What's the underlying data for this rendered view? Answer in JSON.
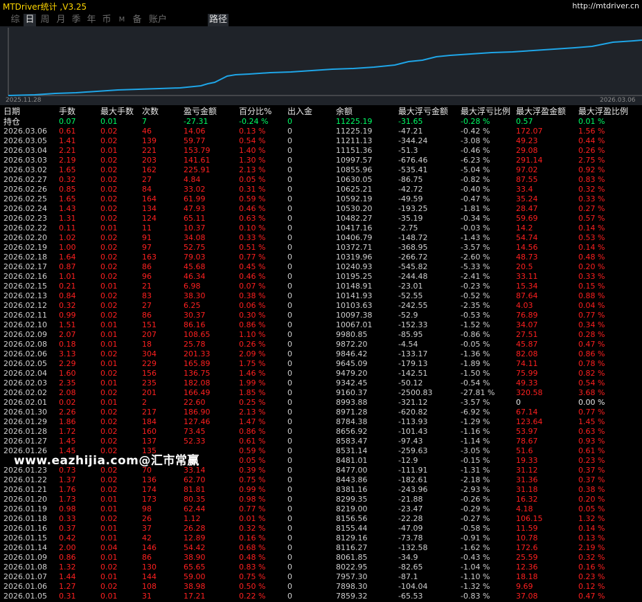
{
  "app": {
    "title": "MTDriver统计 ,V3.25",
    "link": "http://mtdriver.cn"
  },
  "tabs": [
    {
      "label": "综",
      "active": false
    },
    {
      "label": "日",
      "active": true
    },
    {
      "label": "周",
      "active": false
    },
    {
      "label": "月",
      "active": false
    },
    {
      "label": "季",
      "active": false
    },
    {
      "label": "年",
      "active": false
    },
    {
      "label": "币",
      "active": false
    },
    {
      "label": "M",
      "active": false
    },
    {
      "label": "备",
      "active": false
    },
    {
      "label": "账户",
      "active": false
    },
    {
      "label": "路径",
      "active": true
    }
  ],
  "chart": {
    "start_date": "2025.11.28",
    "end_date": "2026.03.06",
    "line_color": "#1fa6e8"
  },
  "headers": [
    "日期",
    "手数",
    "最大手数",
    "次数",
    "盈亏金额",
    "百分比%",
    "出入金",
    "余额",
    "最大浮亏金额",
    "最大浮亏比例",
    "最大浮盈金额",
    "最大浮盈比例"
  ],
  "holding": [
    "持仓",
    "0.07",
    "0.01",
    "7",
    "-27.31",
    "-0.24 %",
    "0",
    "11225.19",
    "-31.65",
    "-0.28 %",
    "0.57",
    "0.01 %"
  ],
  "rows": [
    [
      "2026.03.06",
      "0.61",
      "0.02",
      "46",
      "14.06",
      "0.13 %",
      "0",
      "11225.19",
      "-47.21",
      "-0.42 %",
      "172.07",
      "1.56 %"
    ],
    [
      "2026.03.05",
      "1.41",
      "0.02",
      "139",
      "59.77",
      "0.54 %",
      "0",
      "11211.13",
      "-344.24",
      "-3.08 %",
      "49.23",
      "0.44 %"
    ],
    [
      "2026.03.04",
      "2.21",
      "0.01",
      "221",
      "153.79",
      "1.40 %",
      "0",
      "11151.36",
      "-51.3",
      "-0.46 %",
      "29.08",
      "0.26 %"
    ],
    [
      "2026.03.03",
      "2.19",
      "0.02",
      "203",
      "141.61",
      "1.30 %",
      "0",
      "10997.57",
      "-676.46",
      "-6.23 %",
      "291.14",
      "2.75 %"
    ],
    [
      "2026.03.02",
      "1.65",
      "0.02",
      "162",
      "225.91",
      "2.13 %",
      "0",
      "10855.96",
      "-535.41",
      "-5.04 %",
      "97.02",
      "0.92 %"
    ],
    [
      "2026.02.27",
      "0.32",
      "0.02",
      "27",
      "4.84",
      "0.05 %",
      "0",
      "10630.05",
      "-86.75",
      "-0.82 %",
      "87.55",
      "0.83 %"
    ],
    [
      "2026.02.26",
      "0.85",
      "0.02",
      "84",
      "33.02",
      "0.31 %",
      "0",
      "10625.21",
      "-42.72",
      "-0.40 %",
      "33.4",
      "0.32 %"
    ],
    [
      "2026.02.25",
      "1.65",
      "0.02",
      "164",
      "61.99",
      "0.59 %",
      "0",
      "10592.19",
      "-49.59",
      "-0.47 %",
      "35.24",
      "0.33 %"
    ],
    [
      "2026.02.24",
      "1.43",
      "0.02",
      "134",
      "47.93",
      "0.46 %",
      "0",
      "10530.20",
      "-193.25",
      "-1.81 %",
      "28.47",
      "0.27 %"
    ],
    [
      "2026.02.23",
      "1.31",
      "0.02",
      "124",
      "65.11",
      "0.63 %",
      "0",
      "10482.27",
      "-35.19",
      "-0.34 %",
      "59.69",
      "0.57 %"
    ],
    [
      "2026.02.22",
      "0.11",
      "0.01",
      "11",
      "10.37",
      "0.10 %",
      "0",
      "10417.16",
      "-2.75",
      "-0.03 %",
      "14.2",
      "0.14 %"
    ],
    [
      "2026.02.20",
      "1.02",
      "0.02",
      "91",
      "34.08",
      "0.33 %",
      "0",
      "10406.79",
      "-148.72",
      "-1.43 %",
      "54.74",
      "0.53 %"
    ],
    [
      "2026.02.19",
      "1.00",
      "0.02",
      "97",
      "52.75",
      "0.51 %",
      "0",
      "10372.71",
      "-368.95",
      "-3.57 %",
      "14.56",
      "0.14 %"
    ],
    [
      "2026.02.18",
      "1.64",
      "0.02",
      "163",
      "79.03",
      "0.77 %",
      "0",
      "10319.96",
      "-266.72",
      "-2.60 %",
      "48.73",
      "0.48 %"
    ],
    [
      "2026.02.17",
      "0.87",
      "0.02",
      "86",
      "45.68",
      "0.45 %",
      "0",
      "10240.93",
      "-545.82",
      "-5.33 %",
      "20.5",
      "0.20 %"
    ],
    [
      "2026.02.16",
      "1.01",
      "0.02",
      "96",
      "46.34",
      "0.46 %",
      "0",
      "10195.25",
      "-244.48",
      "-2.41 %",
      "33.11",
      "0.33 %"
    ],
    [
      "2026.02.15",
      "0.21",
      "0.01",
      "21",
      "6.98",
      "0.07 %",
      "0",
      "10148.91",
      "-23.01",
      "-0.23 %",
      "15.34",
      "0.15 %"
    ],
    [
      "2026.02.13",
      "0.84",
      "0.02",
      "83",
      "38.30",
      "0.38 %",
      "0",
      "10141.93",
      "-52.55",
      "-0.52 %",
      "87.64",
      "0.88 %"
    ],
    [
      "2026.02.12",
      "0.32",
      "0.02",
      "27",
      "6.25",
      "0.06 %",
      "0",
      "10103.63",
      "-242.55",
      "-2.35 %",
      "4.03",
      "0.04 %"
    ],
    [
      "2026.02.11",
      "0.99",
      "0.02",
      "86",
      "30.37",
      "0.30 %",
      "0",
      "10097.38",
      "-52.9",
      "-0.53 %",
      "76.89",
      "0.77 %"
    ],
    [
      "2026.02.10",
      "1.51",
      "0.01",
      "151",
      "86.16",
      "0.86 %",
      "0",
      "10067.01",
      "-152.33",
      "-1.52 %",
      "34.07",
      "0.34 %"
    ],
    [
      "2026.02.09",
      "2.07",
      "0.01",
      "207",
      "108.65",
      "1.10 %",
      "0",
      "9980.85",
      "-85.95",
      "-0.86 %",
      "27.51",
      "0.28 %"
    ],
    [
      "2026.02.08",
      "0.18",
      "0.01",
      "18",
      "25.78",
      "0.26 %",
      "0",
      "9872.20",
      "-4.54",
      "-0.05 %",
      "45.87",
      "0.47 %"
    ],
    [
      "2026.02.06",
      "3.13",
      "0.02",
      "304",
      "201.33",
      "2.09 %",
      "0",
      "9846.42",
      "-133.17",
      "-1.36 %",
      "82.08",
      "0.86 %"
    ],
    [
      "2026.02.05",
      "2.29",
      "0.01",
      "229",
      "165.89",
      "1.75 %",
      "0",
      "9645.09",
      "-179.13",
      "-1.89 %",
      "74.11",
      "0.78 %"
    ],
    [
      "2026.02.04",
      "1.60",
      "0.02",
      "156",
      "136.75",
      "1.46 %",
      "0",
      "9479.20",
      "-142.51",
      "-1.50 %",
      "75.99",
      "0.82 %"
    ],
    [
      "2026.02.03",
      "2.35",
      "0.01",
      "235",
      "182.08",
      "1.99 %",
      "0",
      "9342.45",
      "-50.12",
      "-0.54 %",
      "49.33",
      "0.54 %"
    ],
    [
      "2026.02.02",
      "2.08",
      "0.02",
      "201",
      "166.49",
      "1.85 %",
      "0",
      "9160.37",
      "-2500.83",
      "-27.81 %",
      "320.58",
      "3.68 %"
    ],
    [
      "2026.02.01",
      "0.02",
      "0.01",
      "2",
      "22.60",
      "0.25 %",
      "0",
      "8993.88",
      "-321.12",
      "-3.57 %",
      "0",
      "0.00 %"
    ],
    [
      "2026.01.30",
      "2.26",
      "0.02",
      "217",
      "186.90",
      "2.13 %",
      "0",
      "8971.28",
      "-620.82",
      "-6.92 %",
      "67.14",
      "0.77 %"
    ],
    [
      "2026.01.29",
      "1.86",
      "0.02",
      "184",
      "127.46",
      "1.47 %",
      "0",
      "8784.38",
      "-113.93",
      "-1.29 %",
      "123.64",
      "1.45 %"
    ],
    [
      "2026.01.28",
      "1.72",
      "0.02",
      "160",
      "73.45",
      "0.86 %",
      "0",
      "8656.92",
      "-101.43",
      "-1.16 %",
      "53.97",
      "0.63 %"
    ],
    [
      "2026.01.27",
      "1.45",
      "0.02",
      "137",
      "52.33",
      "0.61 %",
      "0",
      "8583.47",
      "-97.43",
      "-1.14 %",
      "78.67",
      "0.93 %"
    ],
    [
      "2026.01.26",
      "1.45",
      "0.02",
      "135",
      "",
      "0.59 %",
      "0",
      "8531.14",
      "-259.63",
      "-3.05 %",
      "51.6",
      "0.61 %"
    ],
    [
      "",
      "",
      "",
      "",
      "",
      "0.05 %",
      "0",
      "8481.01",
      "-12.9",
      "-0.15 %",
      "19.33",
      "0.23 %"
    ],
    [
      "2026.01.23",
      "0.73",
      "0.02",
      "70",
      "33.14",
      "0.39 %",
      "0",
      "8477.00",
      "-111.91",
      "-1.31 %",
      "31.12",
      "0.37 %"
    ],
    [
      "2026.01.22",
      "1.37",
      "0.02",
      "136",
      "62.70",
      "0.75 %",
      "0",
      "8443.86",
      "-182.61",
      "-2.18 %",
      "31.36",
      "0.37 %"
    ],
    [
      "2026.01.21",
      "1.76",
      "0.02",
      "174",
      "81.81",
      "0.99 %",
      "0",
      "8381.16",
      "-243.96",
      "-2.93 %",
      "31.18",
      "0.38 %"
    ],
    [
      "2026.01.20",
      "1.73",
      "0.01",
      "173",
      "80.35",
      "0.98 %",
      "0",
      "8299.35",
      "-21.88",
      "-0.26 %",
      "16.32",
      "0.20 %"
    ],
    [
      "2026.01.19",
      "0.98",
      "0.01",
      "98",
      "62.44",
      "0.77 %",
      "0",
      "8219.00",
      "-23.47",
      "-0.29 %",
      "4.18",
      "0.05 %"
    ],
    [
      "2026.01.18",
      "0.33",
      "0.02",
      "26",
      "1.12",
      "0.01 %",
      "0",
      "8156.56",
      "-22.28",
      "-0.27 %",
      "106.15",
      "1.32 %"
    ],
    [
      "2026.01.16",
      "0.37",
      "0.01",
      "37",
      "26.28",
      "0.32 %",
      "0",
      "8155.44",
      "-47.09",
      "-0.58 %",
      "11.59",
      "0.14 %"
    ],
    [
      "2026.01.15",
      "0.42",
      "0.01",
      "42",
      "12.89",
      "0.16 %",
      "0",
      "8129.16",
      "-73.78",
      "-0.91 %",
      "10.78",
      "0.13 %"
    ],
    [
      "2026.01.14",
      "2.00",
      "0.04",
      "146",
      "54.42",
      "0.68 %",
      "0",
      "8116.27",
      "-132.58",
      "-1.62 %",
      "172.6",
      "2.19 %"
    ],
    [
      "2026.01.09",
      "0.86",
      "0.01",
      "86",
      "38.90",
      "0.48 %",
      "0",
      "8061.85",
      "-34.9",
      "-0.43 %",
      "25.59",
      "0.32 %"
    ],
    [
      "2026.01.08",
      "1.32",
      "0.02",
      "130",
      "65.65",
      "0.83 %",
      "0",
      "8022.95",
      "-82.65",
      "-1.04 %",
      "12.36",
      "0.16 %"
    ],
    [
      "2026.01.07",
      "1.44",
      "0.01",
      "144",
      "59.00",
      "0.75 %",
      "0",
      "7957.30",
      "-87.1",
      "-1.10 %",
      "18.18",
      "0.23 %"
    ],
    [
      "2026.01.06",
      "1.27",
      "0.02",
      "108",
      "38.98",
      "0.50 %",
      "0",
      "7898.30",
      "-104.04",
      "-1.32 %",
      "9.69",
      "0.12 %"
    ],
    [
      "2026.01.05",
      "0.31",
      "0.01",
      "31",
      "17.21",
      "0.22 %",
      "0",
      "7859.32",
      "-65.53",
      "-0.83 %",
      "37.08",
      "0.47 %"
    ]
  ],
  "watermark": "www.eazhijia.com@汇市常赢"
}
